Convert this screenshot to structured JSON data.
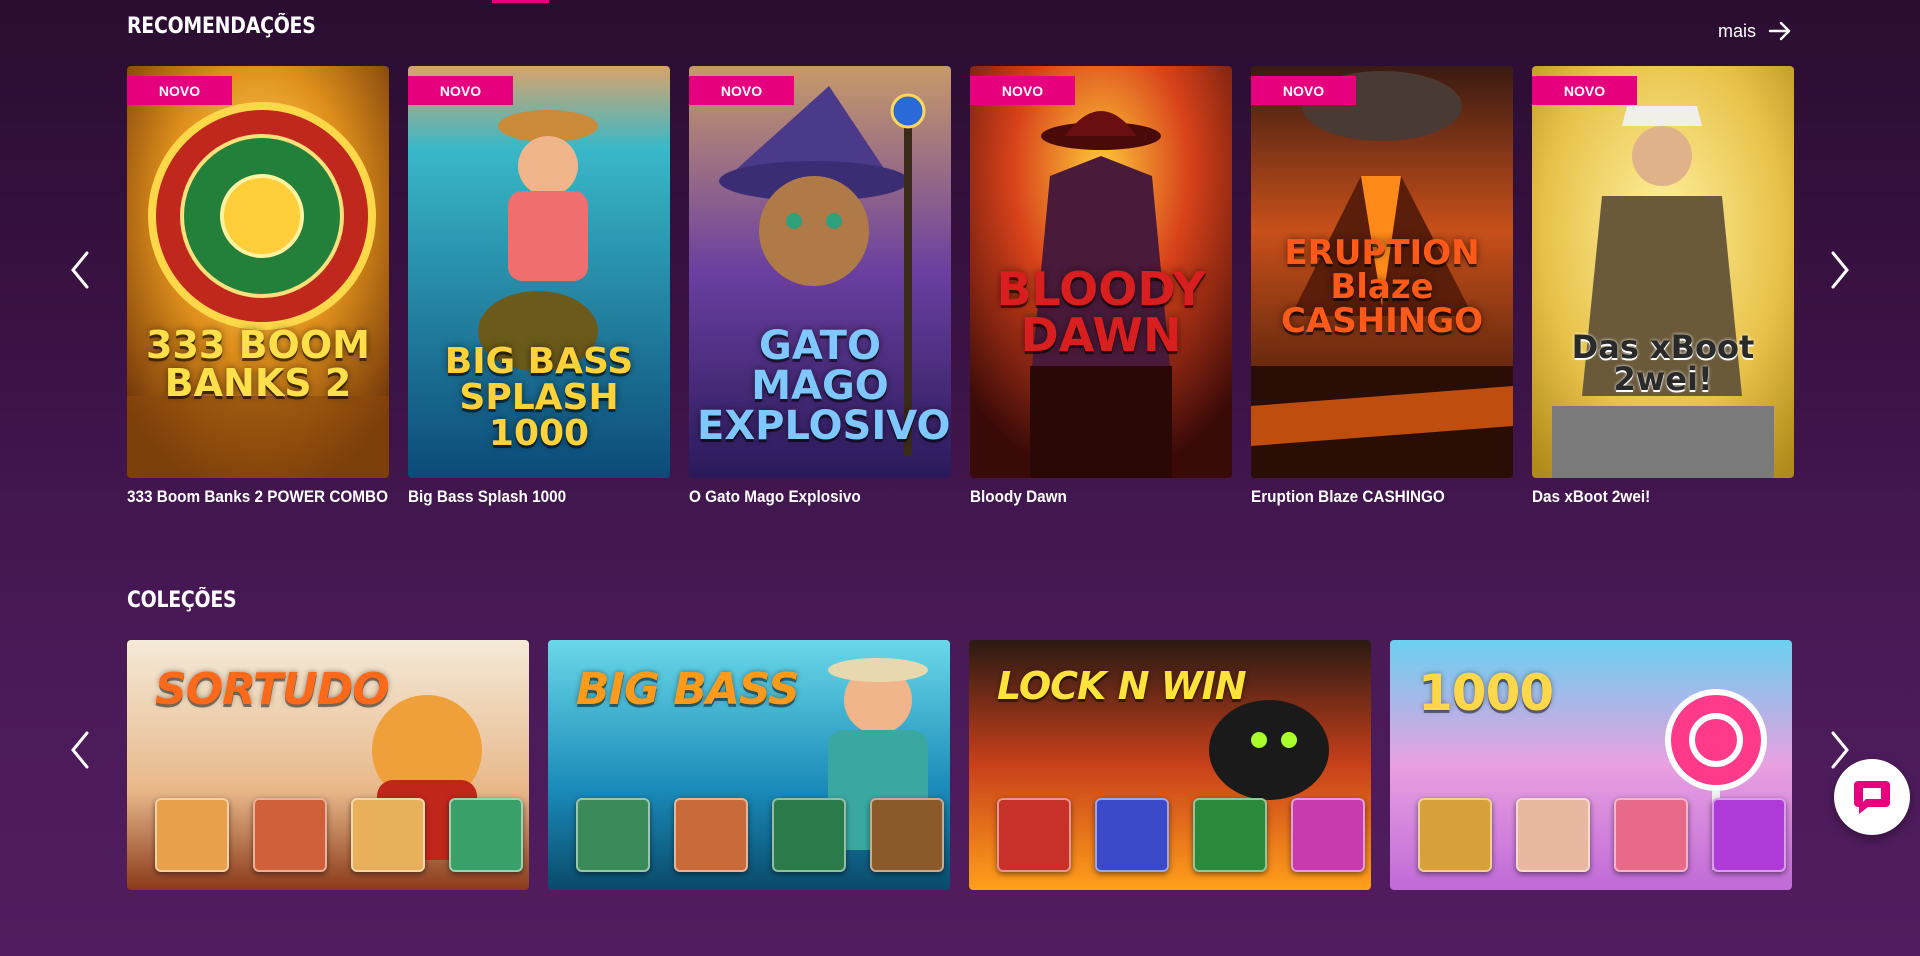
{
  "recommendations": {
    "title": "RECOMENDAÇÕES",
    "more_label": "mais",
    "badge_label": "NOVO",
    "games": [
      {
        "name": "333 Boom Banks 2 POWER COMBO",
        "logo": "333 BOOM BANKS 2",
        "badge": "NOVO"
      },
      {
        "name": "Big Bass Splash 1000",
        "logo": "BIG BASS SPLASH 1000",
        "badge": "NOVO"
      },
      {
        "name": "O Gato Mago Explosivo",
        "logo": "GATO MAGO EXPLOSIVO",
        "badge": "NOVO"
      },
      {
        "name": "Bloody Dawn",
        "logo": "BLOODY DAWN",
        "badge": "NOVO"
      },
      {
        "name": "Eruption Blaze CASHINGO",
        "logo": "ERUPTION Blaze CASHINGO",
        "badge": "NOVO"
      },
      {
        "name": "Das xBoot 2wei!",
        "logo": "Das xBoot 2wei!",
        "badge": "NOVO"
      }
    ]
  },
  "collections": {
    "title": "COLEÇÕES",
    "items": [
      {
        "logo": "SORTUDO"
      },
      {
        "logo": "BIG BASS"
      },
      {
        "logo": "LOCK N WIN"
      },
      {
        "logo": "1000"
      }
    ]
  },
  "icons": {
    "prev": "chevron-left-icon",
    "next": "chevron-right-icon",
    "more": "arrow-right-icon",
    "chat": "chat-bubble-icon"
  },
  "colors": {
    "accent": "#e6007e",
    "background_top": "#2a0d30",
    "background_bottom": "#521d60"
  }
}
